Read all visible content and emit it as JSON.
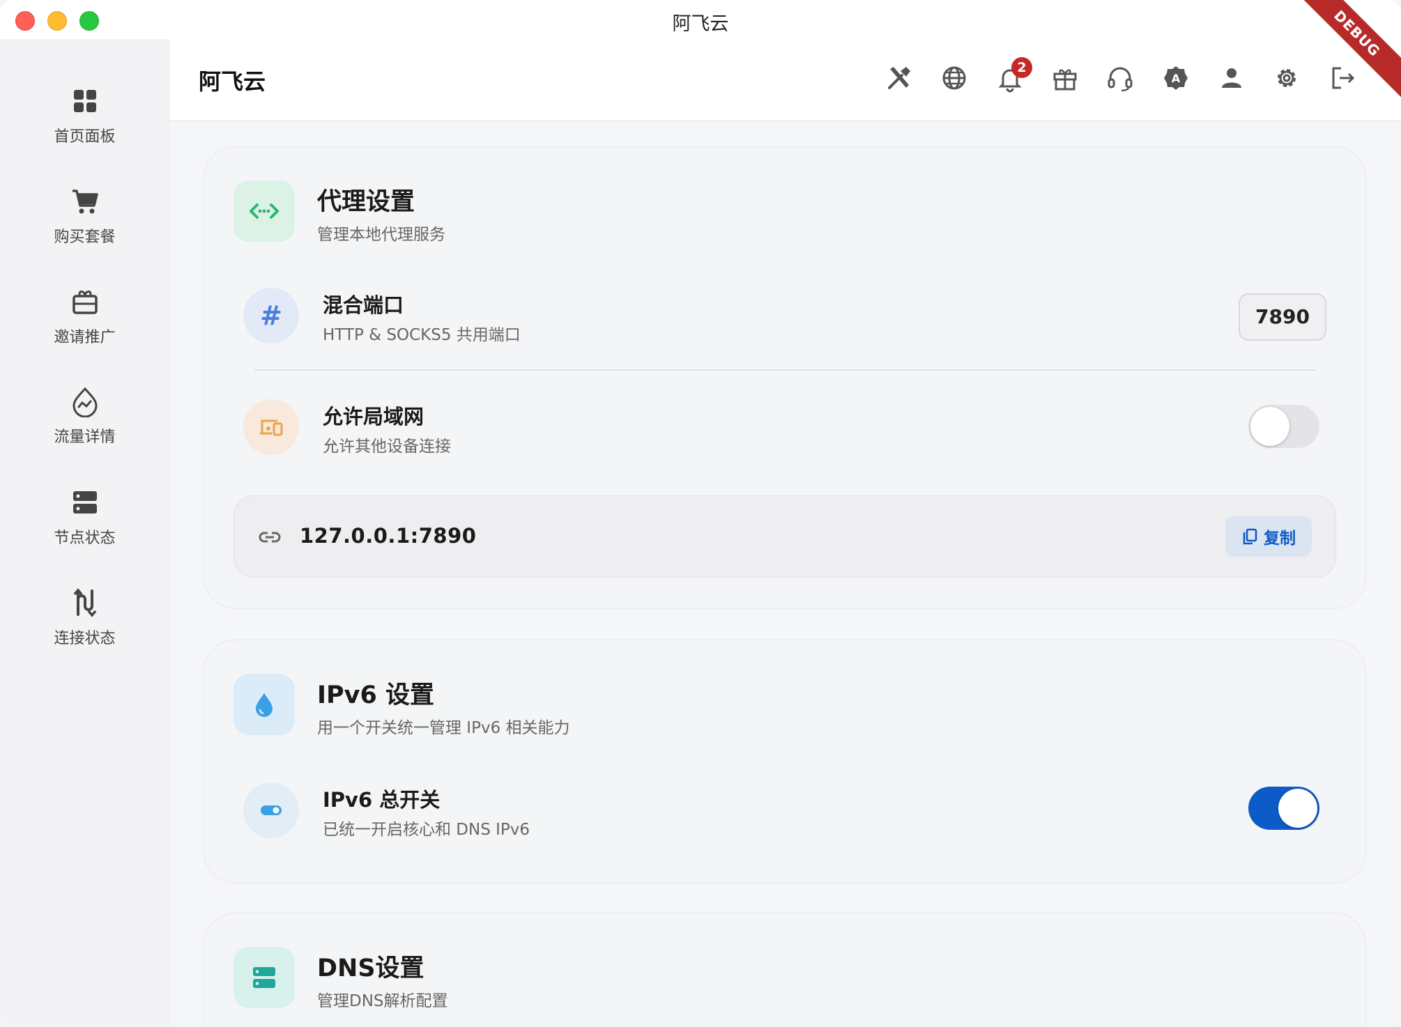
{
  "window": {
    "title": "阿飞云",
    "debug_label": "DEBUG"
  },
  "header": {
    "title": "阿飞云",
    "notification_count": "2"
  },
  "sidebar": {
    "items": [
      {
        "label": "首页面板",
        "icon": "dashboard-icon"
      },
      {
        "label": "购买套餐",
        "icon": "cart-icon"
      },
      {
        "label": "邀请推广",
        "icon": "gift-box-icon"
      },
      {
        "label": "流量详情",
        "icon": "traffic-icon"
      },
      {
        "label": "节点状态",
        "icon": "server-icon"
      },
      {
        "label": "连接状态",
        "icon": "connection-icon"
      }
    ]
  },
  "proxy": {
    "title": "代理设置",
    "subtitle": "管理本地代理服务",
    "mixed_port": {
      "title": "混合端口",
      "subtitle": "HTTP & SOCKS5 共用端口",
      "value": "7890"
    },
    "lan": {
      "title": "允许局域网",
      "subtitle": "允许其他设备连接",
      "enabled": false
    },
    "address": "127.0.0.1:7890",
    "copy_label": "复制"
  },
  "ipv6": {
    "title": "IPv6 设置",
    "subtitle": "用一个开关统一管理 IPv6 相关能力",
    "master": {
      "title": "IPv6 总开关",
      "subtitle": "已统一开启核心和 DNS IPv6",
      "enabled": true
    }
  },
  "dns": {
    "title": "DNS设置",
    "subtitle": "管理DNS解析配置"
  },
  "colors": {
    "accent": "#0d5bc8",
    "proxy_icon": "#2bb673",
    "port_icon": "#4a7fe0",
    "lan_icon": "#f0a04b",
    "ipv6_icon": "#3aa0e6",
    "dns_icon": "#1fa89a",
    "badge": "#c62828"
  }
}
